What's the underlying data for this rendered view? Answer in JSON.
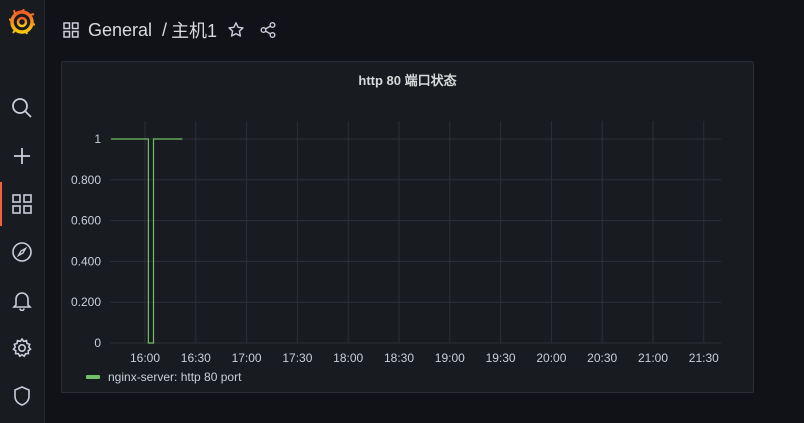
{
  "sidebar": {
    "items": [
      {
        "icon": "grafana-logo-icon"
      },
      {
        "icon": "search-icon"
      },
      {
        "icon": "plus-icon"
      },
      {
        "icon": "dashboards-icon",
        "active": true
      },
      {
        "icon": "compass-icon"
      },
      {
        "icon": "bell-icon"
      },
      {
        "icon": "gear-icon"
      },
      {
        "icon": "shield-icon"
      }
    ],
    "accent": "#f55f3e"
  },
  "header": {
    "folder": "General",
    "separator": "/",
    "dashboard": "主机1"
  },
  "panel": {
    "title": "http 80 端口状态",
    "legend": "nginx-server: http 80 port"
  },
  "chart_data": {
    "type": "line",
    "title": "http 80 端口状态",
    "x_ticks": [
      "16:00",
      "16:30",
      "17:00",
      "17:30",
      "18:00",
      "18:30",
      "19:00",
      "19:30",
      "20:00",
      "20:30",
      "21:00",
      "21:30"
    ],
    "y_ticks": [
      "0",
      "0.200",
      "0.400",
      "0.600",
      "0.800",
      "1"
    ],
    "ylim": [
      0,
      1
    ],
    "grid": true,
    "legend_position": "bottom-left",
    "series": [
      {
        "name": "nginx-server: http 80 port",
        "color": "#73bf69",
        "points": [
          {
            "x": "15:40",
            "y": 1
          },
          {
            "x": "16:02",
            "y": 1
          },
          {
            "x": "16:02",
            "y": 0
          },
          {
            "x": "16:05",
            "y": 0
          },
          {
            "x": "16:05",
            "y": 1
          },
          {
            "x": "16:22",
            "y": 1
          }
        ]
      }
    ]
  }
}
